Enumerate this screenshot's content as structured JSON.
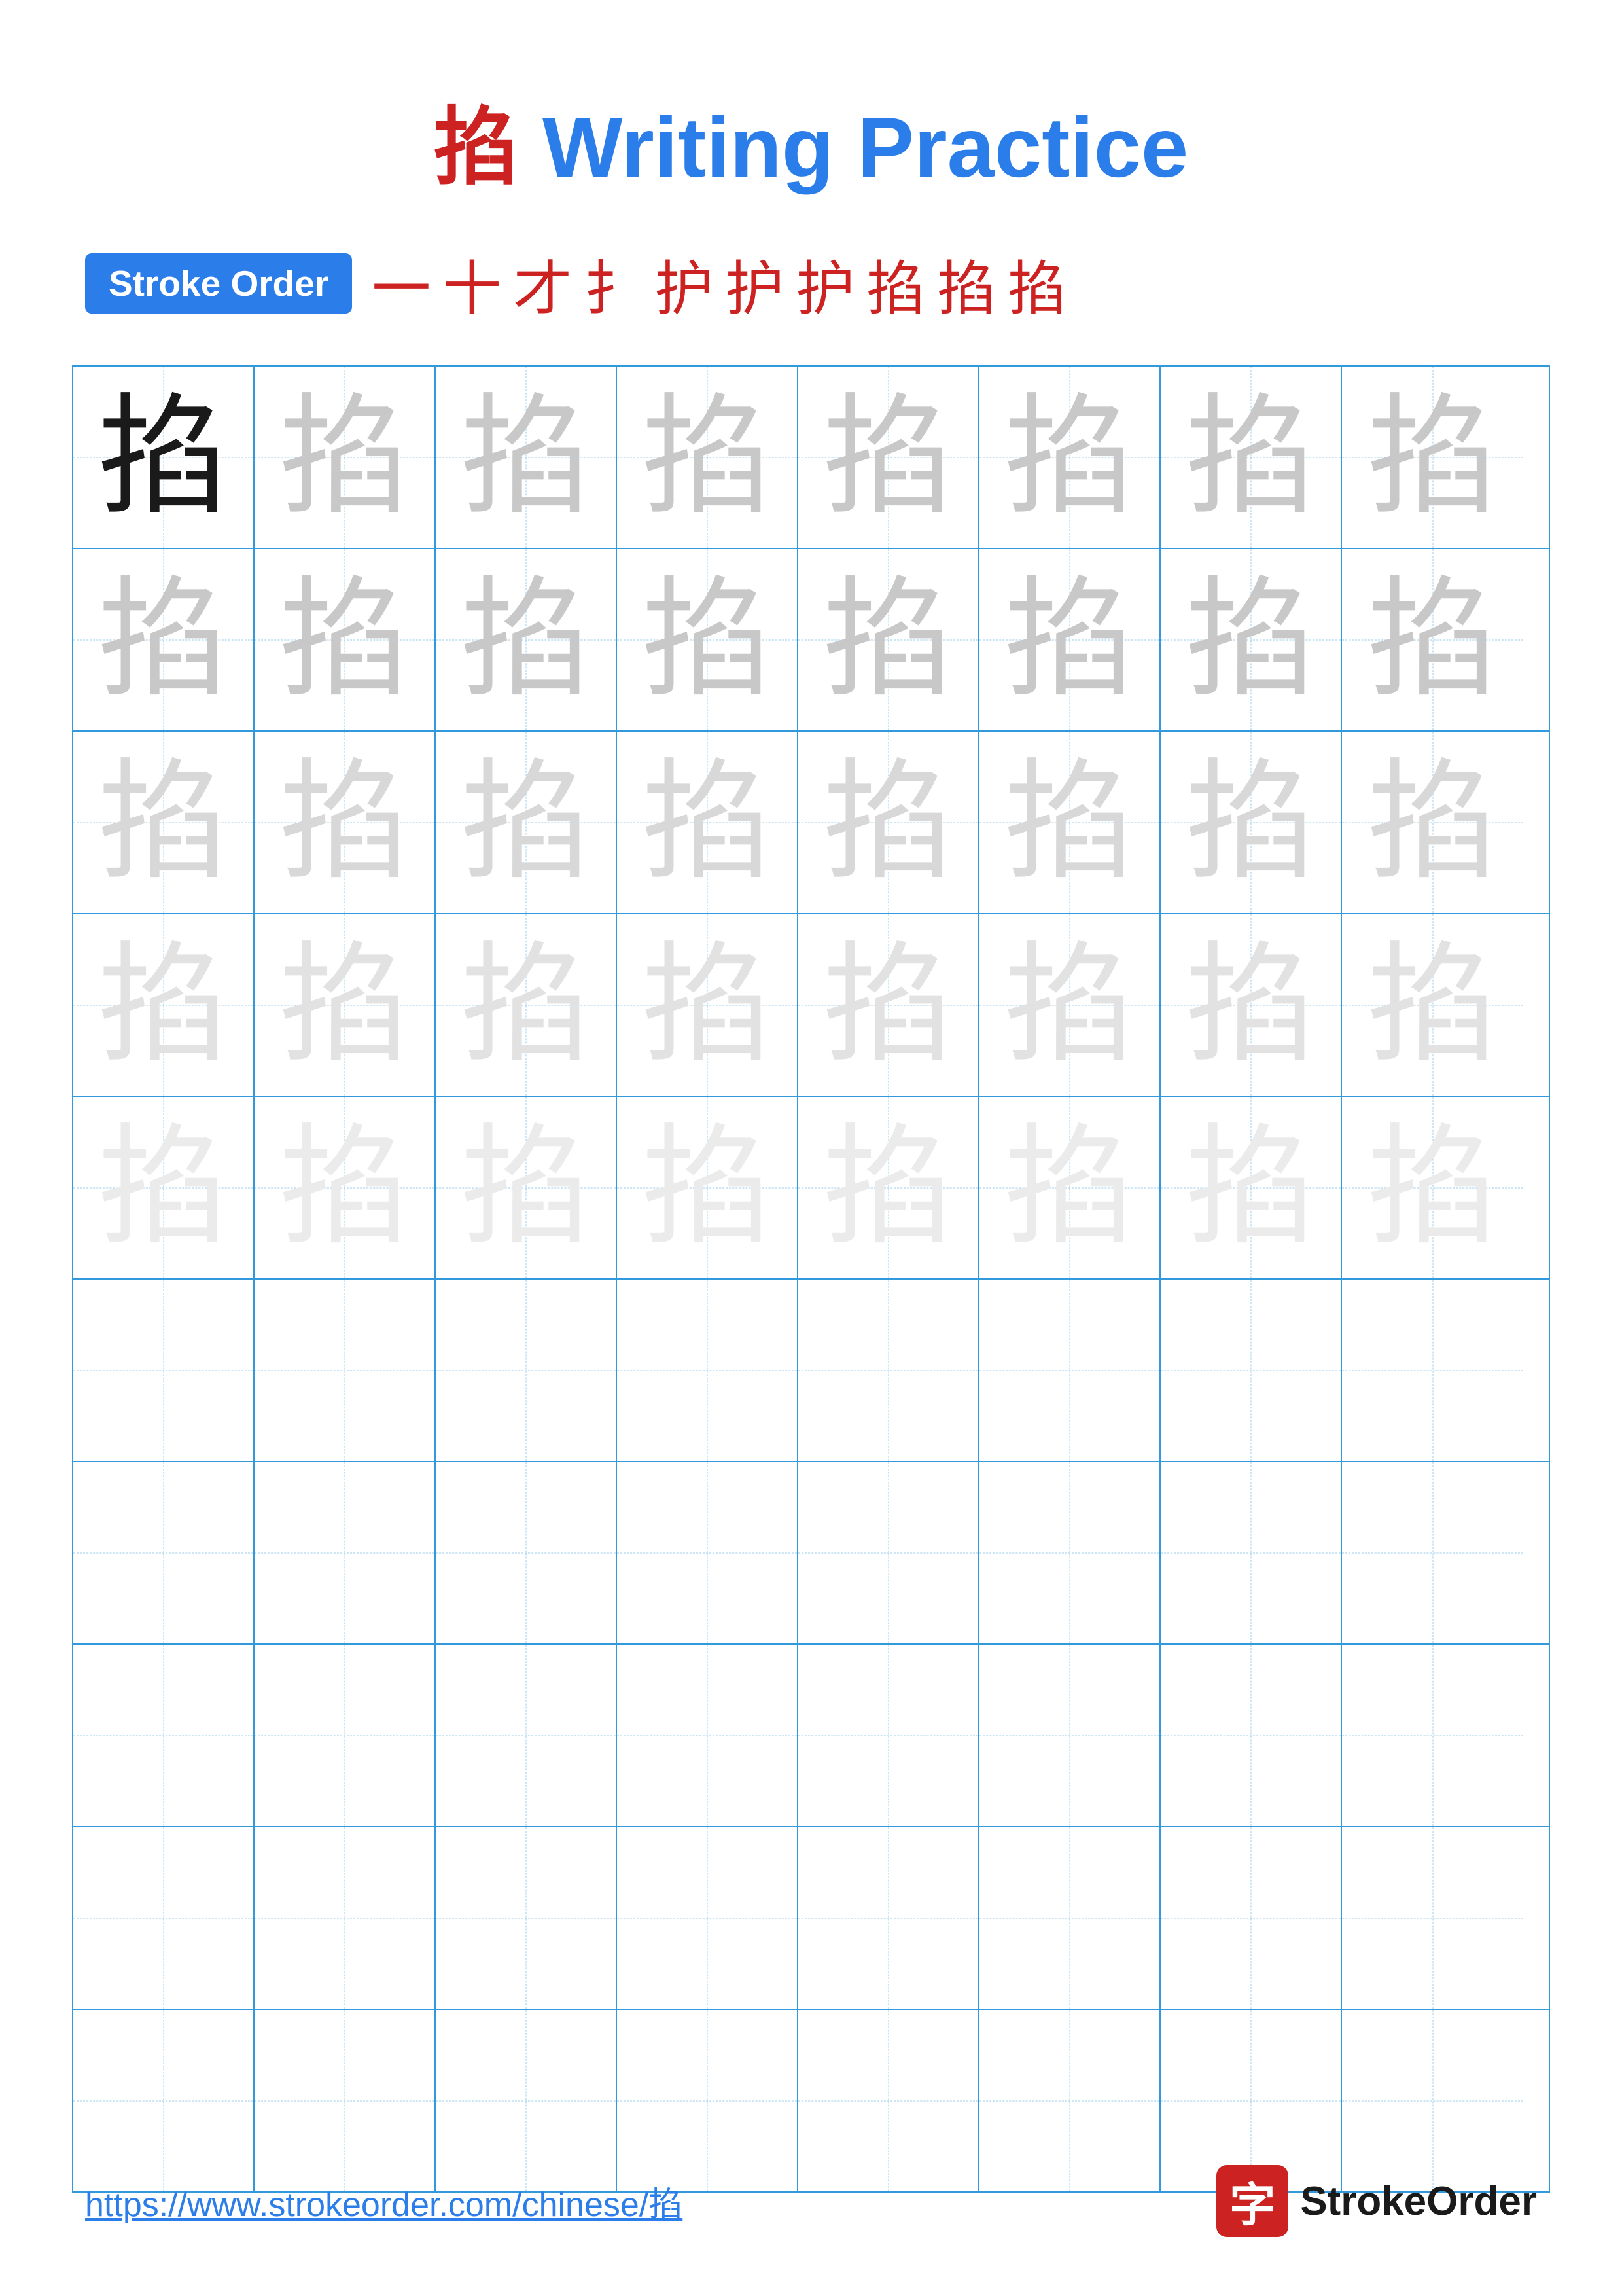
{
  "title": "掐 Writing Practice",
  "title_char": "掐",
  "title_suffix": " Writing Practice",
  "stroke_order": {
    "badge_label": "Stroke Order",
    "strokes": [
      "一",
      "十",
      "才",
      "扌",
      "扌",
      "护",
      "护",
      "掐",
      "掐",
      "掐"
    ]
  },
  "character": "掐",
  "grid": {
    "rows": 10,
    "cols": 8,
    "char_rows": [
      {
        "opacity_class": "char-solid"
      },
      {
        "opacity_class": "char-light1"
      },
      {
        "opacity_class": "char-light1"
      },
      {
        "opacity_class": "char-light2"
      },
      {
        "opacity_class": "char-light3"
      },
      {
        "opacity_class": ""
      },
      {
        "opacity_class": ""
      },
      {
        "opacity_class": ""
      },
      {
        "opacity_class": ""
      },
      {
        "opacity_class": ""
      }
    ]
  },
  "footer": {
    "url": "https://www.strokeorder.com/chinese/掐",
    "logo_char": "字",
    "logo_text": "StrokeOrder"
  },
  "colors": {
    "blue": "#2b7de9",
    "red": "#cc2222",
    "light_blue": "#3399dd",
    "dashed": "#99ccee"
  }
}
